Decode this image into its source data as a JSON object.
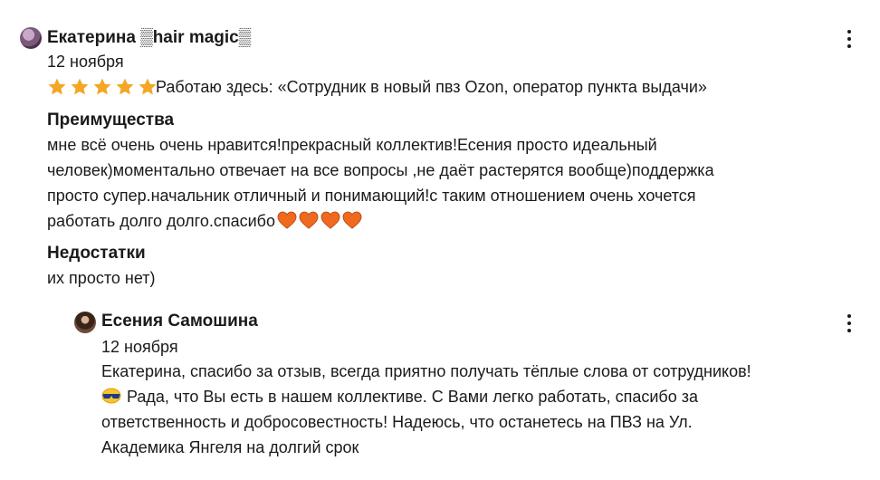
{
  "review": {
    "author": "Екатерина ▒hair magic▒",
    "date": "12 ноября",
    "rating": 5,
    "rating_max": 5,
    "job": "Работаю здесь: «Сотрудник в новый пвз Ozon, оператор пункта выдачи»",
    "pros_title": "Преимущества",
    "pros_lines": [
      "мне всё очень очень нравится!прекрасный коллектив!Есения просто идеальный",
      "человек)моментально отвечает на все вопросы ,не даёт растерятся вообще)поддержка",
      "просто супер.начальник отличный и понимающий!с таким отношением очень хочется",
      "работать долго долго.спасибо"
    ],
    "pros_heart_count": 4,
    "cons_title": "Недостатки",
    "cons_text": "их просто нет)"
  },
  "reply": {
    "author": "Есения Самошина",
    "date": "12 ноября",
    "lines": [
      "Екатерина, спасибо за отзыв, всегда приятно получать тёплые слова от сотрудников!",
      "Рада, что Вы есть в нашем коллективе. С Вами легко работать, спасибо за",
      "ответственность и добросовестность! Надеюсь, что останетесь на ПВЗ на Ул.",
      "Академика Янгеля на долгий срок"
    ]
  },
  "colors": {
    "star": "#f5a623",
    "heart": "#ef6a1f",
    "text": "#1a1a1a"
  },
  "icons": {
    "menu": "more-vertical-icon",
    "star": "star-icon",
    "heart": "orange-heart-icon",
    "emoji": "sun-with-sunglasses-icon"
  }
}
